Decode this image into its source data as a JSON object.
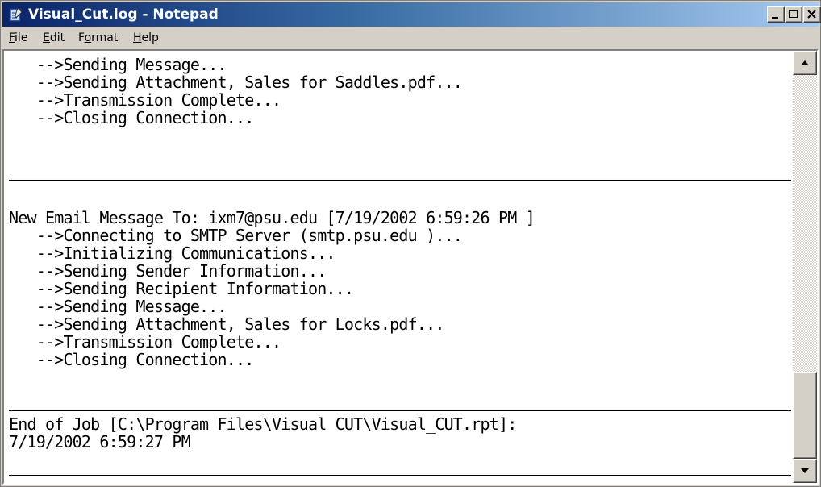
{
  "window": {
    "title": "Visual_Cut.log - Notepad",
    "title_color": "#ffffff",
    "title_gradient": [
      "#0a246a",
      "#a6caf0"
    ],
    "icons": {
      "app": "notepad-icon",
      "minimize": "minimize-icon",
      "maximize": "maximize-icon",
      "close": "close-icon"
    }
  },
  "menu": {
    "file": {
      "accel": "F",
      "rest": "ile"
    },
    "edit": {
      "accel": "E",
      "rest": "dit"
    },
    "format": {
      "pre": "F",
      "accel": "o",
      "rest": "rmat"
    },
    "help": {
      "accel": "H",
      "rest": "elp"
    }
  },
  "log": {
    "block1": [
      "   -->Sending Message...",
      "   -->Sending Attachment, Sales for Saddles.pdf...",
      "   -->Transmission Complete...",
      "   -->Closing Connection..."
    ],
    "block2": [
      "New Email Message To: ixm7@psu.edu [7/19/2002 6:59:26 PM ]",
      "   -->Connecting to SMTP Server (smtp.psu.edu )...",
      "   -->Initializing Communications...",
      "   -->Sending Sender Information...",
      "   -->Sending Recipient Information...",
      "   -->Sending Message...",
      "   -->Sending Attachment, Sales for Locks.pdf...",
      "   -->Transmission Complete...",
      "   -->Closing Connection..."
    ],
    "block3": [
      "End of Job [C:\\Program Files\\Visual CUT\\Visual_CUT.rpt]:",
      "7/19/2002 6:59:27 PM"
    ]
  },
  "scrollbar": {
    "position": 0.93,
    "icons": {
      "up": "arrow-up-icon",
      "down": "arrow-down-icon"
    }
  }
}
